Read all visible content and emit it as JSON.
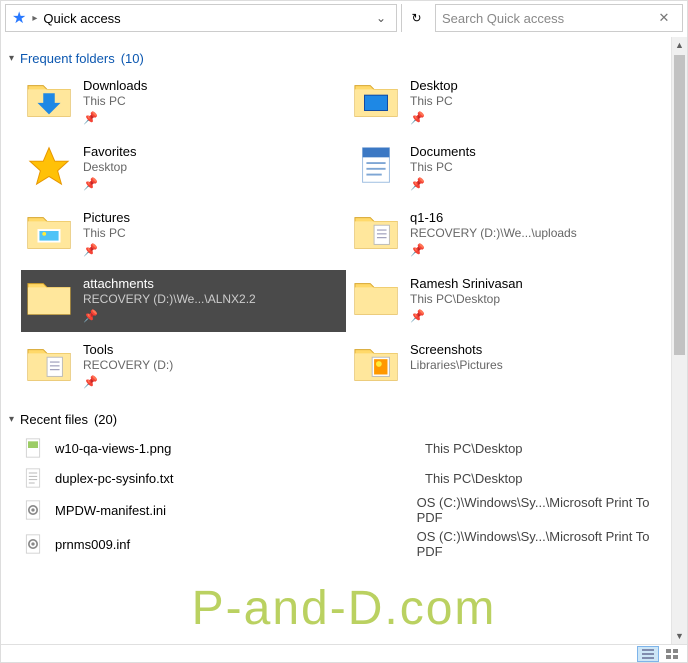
{
  "addressbar": {
    "title": "Quick access",
    "search_placeholder": "Search Quick access"
  },
  "sections": {
    "frequent": {
      "label": "Frequent folders",
      "count": "(10)"
    },
    "recent": {
      "label": "Recent files",
      "count": "(20)"
    }
  },
  "folders": [
    {
      "name": "Downloads",
      "loc": "This PC",
      "icon": "downloads",
      "pinned": true
    },
    {
      "name": "Desktop",
      "loc": "This PC",
      "icon": "desktop",
      "pinned": true
    },
    {
      "name": "Favorites",
      "loc": "Desktop",
      "icon": "favorites",
      "pinned": true
    },
    {
      "name": "Documents",
      "loc": "This PC",
      "icon": "documents",
      "pinned": true
    },
    {
      "name": "Pictures",
      "loc": "This PC",
      "icon": "pictures",
      "pinned": true
    },
    {
      "name": "q1-16",
      "loc": "RECOVERY (D:)\\We...\\uploads",
      "icon": "folder-doc",
      "pinned": true
    },
    {
      "name": "attachments",
      "loc": "RECOVERY (D:)\\We...\\ALNX2.2",
      "icon": "folder",
      "pinned": true,
      "selected": true
    },
    {
      "name": "Ramesh Srinivasan",
      "loc": "This PC\\Desktop",
      "icon": "folder",
      "pinned": true
    },
    {
      "name": "Tools",
      "loc": "RECOVERY (D:)",
      "icon": "folder-doc",
      "pinned": true
    },
    {
      "name": "Screenshots",
      "loc": "Libraries\\Pictures",
      "icon": "folder-pic",
      "pinned": false
    }
  ],
  "files": [
    {
      "name": "w10-qa-views-1.png",
      "loc": "This PC\\Desktop",
      "icon": "image"
    },
    {
      "name": "duplex-pc-sysinfo.txt",
      "loc": "This PC\\Desktop",
      "icon": "text"
    },
    {
      "name": "MPDW-manifest.ini",
      "loc": "OS (C:)\\Windows\\Sy...\\Microsoft Print To PDF",
      "icon": "ini"
    },
    {
      "name": "prnms009.inf",
      "loc": "OS (C:)\\Windows\\Sy...\\Microsoft Print To PDF",
      "icon": "ini"
    }
  ],
  "watermark": "P-and-D.com"
}
